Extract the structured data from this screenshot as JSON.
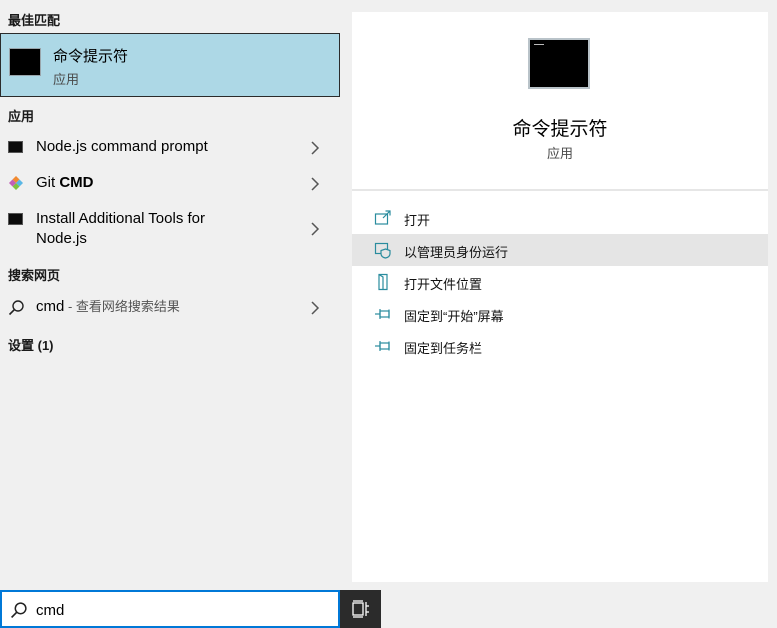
{
  "left": {
    "best_match_header": "最佳匹配",
    "best_match": {
      "title": "命令提示符",
      "subtitle": "应用",
      "icon": "terminal-icon"
    },
    "apps_header": "应用",
    "apps": [
      {
        "label": "Node.js command prompt",
        "icon": "terminal-icon"
      },
      {
        "label_prefix": "Git ",
        "label_bold": "CMD",
        "icon": "git-diamond-icon"
      },
      {
        "label_line1": "Install Additional Tools for",
        "label_line2": "Node.js",
        "icon": "terminal-icon"
      }
    ],
    "web_header": "搜索网页",
    "web_result": {
      "query": "cmd",
      "hint": " - 查看网络搜索结果",
      "icon": "search-icon"
    },
    "settings_header": "设置 (1)"
  },
  "preview": {
    "title": "命令提示符",
    "subtitle": "应用",
    "actions": [
      {
        "label": "打开",
        "icon": "open-icon"
      },
      {
        "label": "以管理员身份运行",
        "icon": "run-as-admin-icon"
      },
      {
        "label": "打开文件位置",
        "icon": "file-location-icon"
      },
      {
        "label": "固定到“开始”屏幕",
        "icon": "pin-icon"
      },
      {
        "label": "固定到任务栏",
        "icon": "pin-icon"
      }
    ],
    "hovered_action": 1
  },
  "search": {
    "value": "cmd",
    "icon": "search-icon"
  },
  "task_view": {
    "icon": "task-view-icon"
  },
  "colors": {
    "accent": "#0078d7",
    "selection": "#add8e6",
    "icon_teal": "#2a8c9e",
    "hover": "#e5e5e5"
  }
}
